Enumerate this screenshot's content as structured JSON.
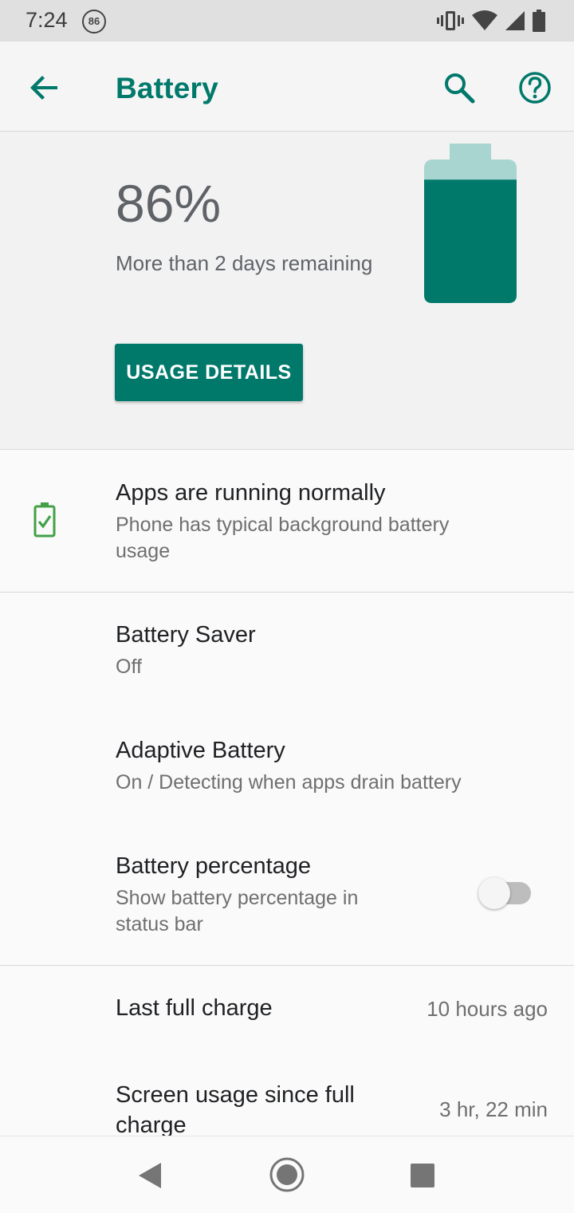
{
  "status_bar": {
    "time": "7:24",
    "notification_badge": "86",
    "icons": [
      "vibrate-icon",
      "wifi-icon",
      "signal-icon",
      "battery-icon"
    ]
  },
  "app_bar": {
    "title": "Battery",
    "back_icon": "arrow-back-icon",
    "search_icon": "search-icon",
    "help_icon": "help-circle-icon"
  },
  "header": {
    "percentage": "86%",
    "remaining": "More than 2 days remaining",
    "usage_button": "USAGE DETAILS",
    "battery_level": 0.86
  },
  "tip": {
    "title": "Apps are running normally",
    "subtitle_line1": "Phone has typical background battery",
    "subtitle_line2": "usage",
    "icon": "battery-check-icon"
  },
  "settings": {
    "battery_saver": {
      "title": "Battery Saver",
      "subtitle": "Off"
    },
    "adaptive_battery": {
      "title": "Adaptive Battery",
      "subtitle": "On / Detecting when apps drain battery"
    },
    "battery_percentage": {
      "title": "Battery percentage",
      "subtitle_line1": "Show battery percentage in",
      "subtitle_line2": "status bar",
      "enabled": false
    }
  },
  "stats": {
    "last_full_charge": {
      "label": "Last full charge",
      "value": "10 hours ago"
    },
    "screen_usage": {
      "label_line1": "Screen usage since full",
      "label_line2": "charge",
      "value": "3 hr, 22 min"
    }
  },
  "colors": {
    "accent": "#00796b",
    "tip_icon": "#43a047"
  }
}
